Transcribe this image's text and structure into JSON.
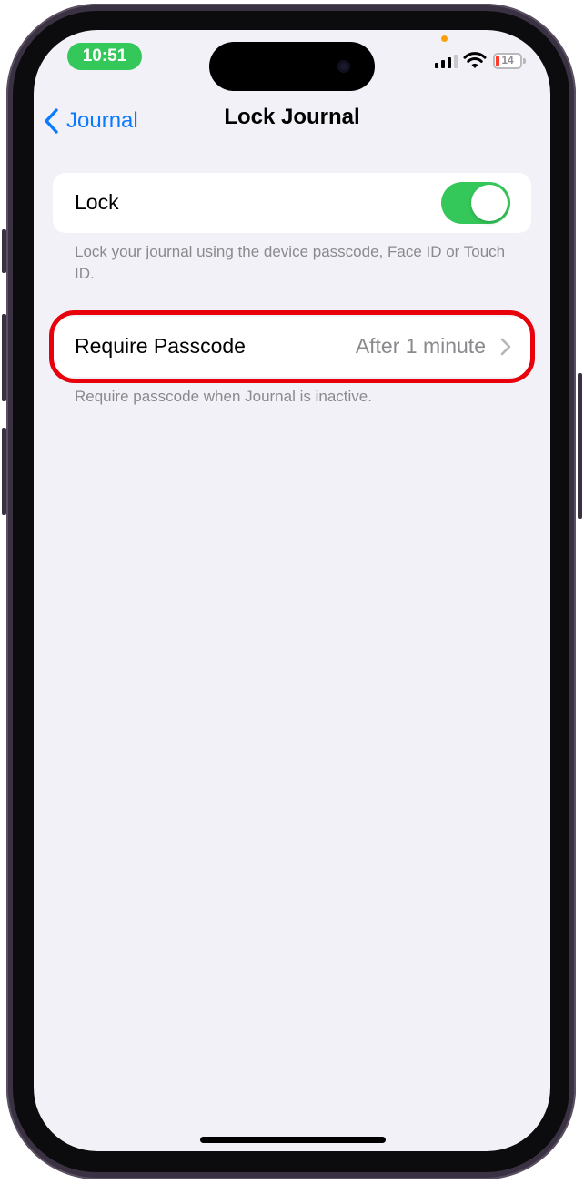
{
  "status_bar": {
    "time": "10:51",
    "battery_level": "14",
    "battery_color": "#ff3b30",
    "signal_bars_active": 3,
    "signal_bars_total": 4,
    "icons": [
      "signal-icon",
      "wifi-icon",
      "battery-icon"
    ]
  },
  "nav": {
    "back_label": "Journal",
    "back_icon": "chevron-left-icon",
    "title": "Lock Journal"
  },
  "lock_section": {
    "label": "Lock",
    "toggle_on": true,
    "toggle_color": "#34c759",
    "footnote": "Lock your journal using the device passcode, Face ID or Touch ID."
  },
  "passcode_section": {
    "label": "Require Passcode",
    "value": "After 1 minute",
    "chevron_icon": "chevron-right-icon",
    "footnote": "Require passcode when Journal is inactive.",
    "highlight_color": "#e8000b"
  },
  "colors": {
    "accent": "#0a7aff",
    "background": "#f2f1f7",
    "secondary_text": "#8a8a8e"
  }
}
